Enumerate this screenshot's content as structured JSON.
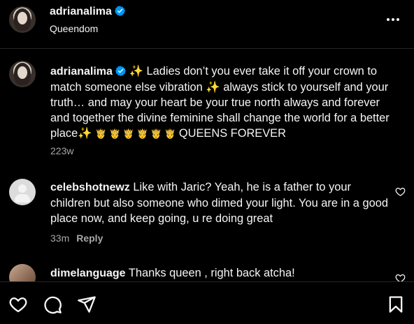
{
  "header": {
    "username": "adrianalima",
    "subtitle": "Queendom"
  },
  "caption": {
    "username": "adrianalima",
    "text_1": " Ladies don’t you ever take it off your crown to match someone else vibration ",
    "text_2": " always stick to yourself and your truth… and may your heart be your true north always and forever and together the divine feminine shall change the world for a better place",
    "text_3": " QUEENS FOREVER",
    "sparkle": "✨",
    "crowns": "🤴 🤴 🤴 🤴 🤴 🤴",
    "time": "223w"
  },
  "comments": [
    {
      "username": "celebshotnewz",
      "text": " Like with Jaric? Yeah, he is a father to your children but also someone who dimed your light. You are in a good place now, and keep going, u re doing great",
      "time": "33m",
      "reply_label": "Reply"
    },
    {
      "username": "dimelanguage",
      "text": " Thanks queen , right back atcha!"
    }
  ],
  "colors": {
    "background": "#000000",
    "text": "#f5f5f5",
    "secondary_text": "#a8a8a8",
    "verified_blue": "#0095f6"
  },
  "icons": {
    "more": "more-horizontal-icon",
    "like": "heart-icon",
    "comment": "comment-icon",
    "share": "send-icon",
    "save": "bookmark-icon",
    "verified": "verified-badge-icon"
  }
}
